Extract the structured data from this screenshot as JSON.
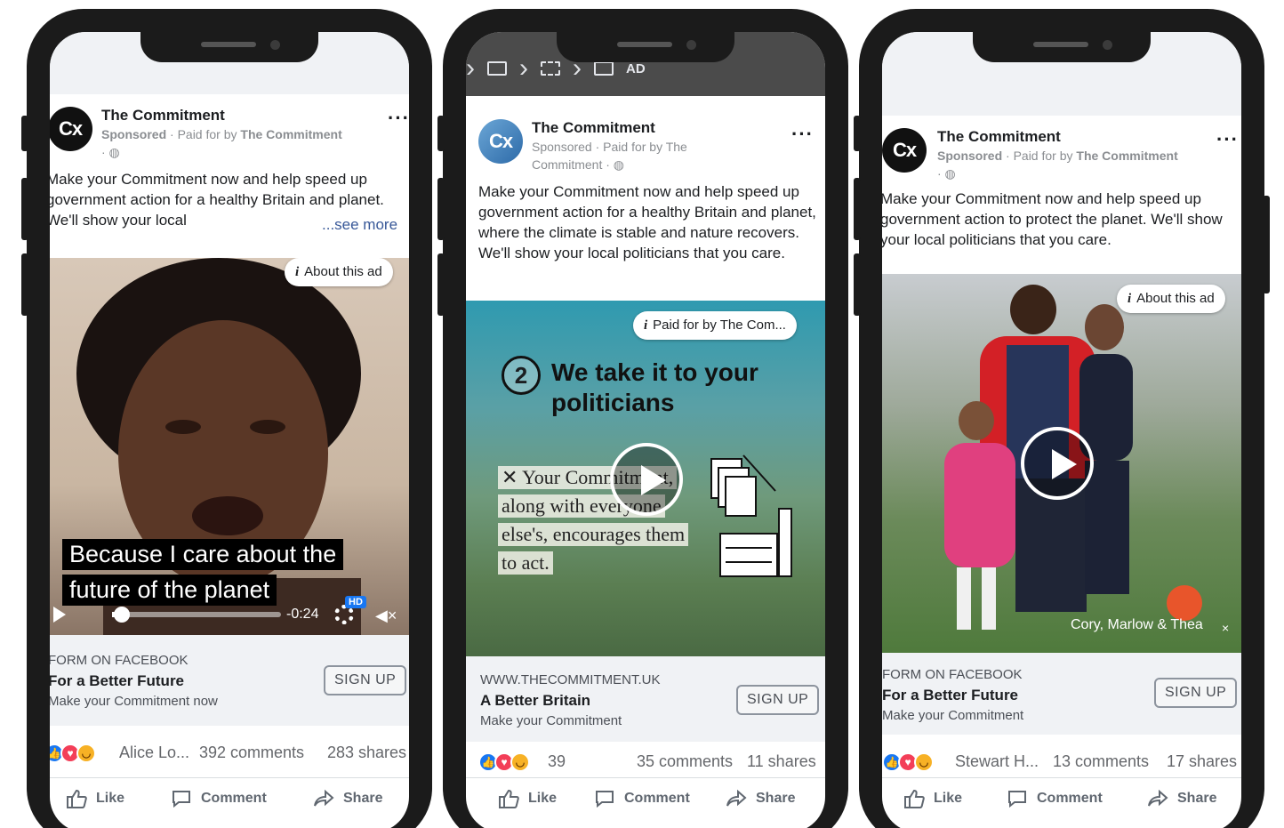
{
  "colors": {
    "facebook_blue": "#1877f2",
    "love_red": "#f33e58",
    "haha_yellow": "#f7b125",
    "cta_bar": "#f0f2f5"
  },
  "phones": [
    {
      "page_name": "The Commitment",
      "avatar_text": "Cx",
      "sponsored_label": "Sponsored",
      "paid_prefix": "· Paid for by",
      "paid_by": "The Commitment",
      "caption": "Make your Commitment now and help speed up government action for a healthy Britain and planet. We'll show your local",
      "see_more": "...see more",
      "about_chip": "About this ad",
      "subtitle_line1": "Because I care about the",
      "subtitle_line2": "future of the planet",
      "video_time": "-0:24",
      "hd_badge": "HD",
      "cta_source": "FORM ON FACEBOOK",
      "cta_title": "For a Better Future",
      "cta_desc": "Make your Commitment now",
      "cta_button": "SIGN UP",
      "reactor": "Alice Lo...",
      "comments": "392 comments",
      "shares": "283 shares",
      "like_label": "Like",
      "comment_label": "Comment",
      "share_label": "Share"
    },
    {
      "breadcrumb_last": "AD",
      "page_name": "The Commitment",
      "avatar_text": "Cx",
      "sponsored_label": "Sponsored",
      "paid_prefix": "· Paid for by The",
      "paid_by": "Commitment",
      "caption": "Make your Commitment now and help speed up government action for a healthy Britain and planet, where the climate is stable and nature recovers. We'll show your local politicians that you care.",
      "about_chip": "Paid for by The Com...",
      "step_number": "2",
      "step_title_line1": "We take it to your",
      "step_title_line2": "politicians",
      "paper_line1": "Your Commitment,",
      "paper_line2": "along with everyone",
      "paper_line3": "else's, encourages them",
      "paper_line4": "to act.",
      "cta_source": "WWW.THECOMMITMENT.UK",
      "cta_title": "A Better Britain",
      "cta_desc": "Make your Commitment",
      "cta_button": "SIGN UP",
      "reaction_count": "39",
      "comments": "35 comments",
      "shares": "11 shares",
      "like_label": "Like",
      "comment_label": "Comment",
      "share_label": "Share"
    },
    {
      "page_name": "The Commitment",
      "avatar_text": "Cx",
      "sponsored_label": "Sponsored",
      "paid_prefix": "· Paid for by",
      "paid_by": "The Commitment",
      "caption": "Make your Commitment now and help speed up government action to protect the planet. We'll show your local politicians that you care.",
      "about_chip": "About this ad",
      "photo_credit": "Cory, Marlow & Thea",
      "cta_source": "FORM ON FACEBOOK",
      "cta_title": "For a Better Future",
      "cta_desc": "Make your Commitment",
      "cta_button": "SIGN UP",
      "reactor": "Stewart H...",
      "comments": "13 comments",
      "shares": "17 shares",
      "like_label": "Like",
      "comment_label": "Comment",
      "share_label": "Share"
    }
  ]
}
